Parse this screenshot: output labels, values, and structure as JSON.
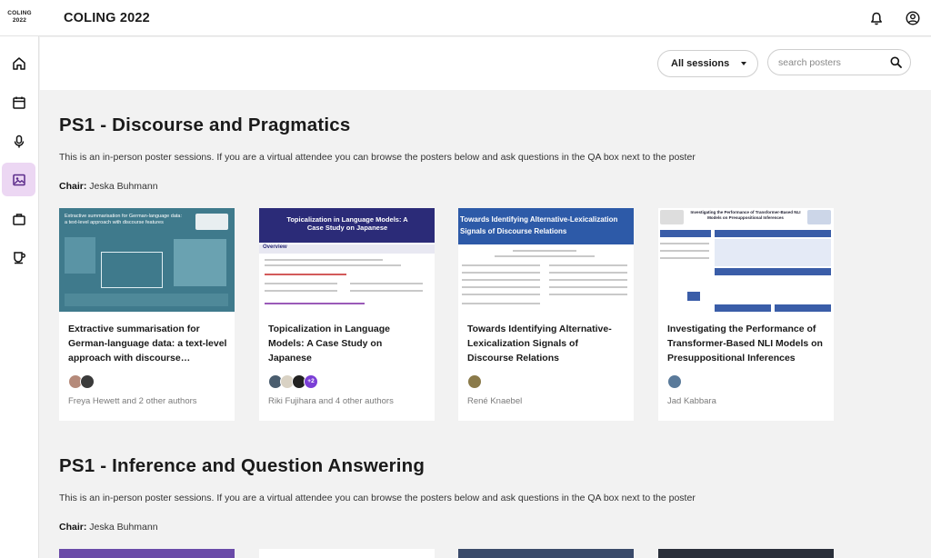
{
  "app": {
    "logo_line1": "COLING",
    "logo_line2": "2022",
    "title": "COLING 2022"
  },
  "topbar": {
    "icons": [
      "bell-icon",
      "account-icon"
    ]
  },
  "rail": {
    "items": [
      {
        "icon": "home-icon",
        "active": false
      },
      {
        "icon": "calendar-icon",
        "active": false
      },
      {
        "icon": "microphone-icon",
        "active": false
      },
      {
        "icon": "poster-image-icon",
        "active": true
      },
      {
        "icon": "briefcase-icon",
        "active": false
      },
      {
        "icon": "coffee-cup-icon",
        "active": false
      }
    ]
  },
  "filters": {
    "session_value": "All sessions",
    "search_placeholder": "search posters"
  },
  "sections": [
    {
      "title": "PS1 - Discourse and Pragmatics",
      "description": "This is an in-person poster sessions. If you are a virtual attendee you can browse the posters below and ask questions in the QA box next to the poster",
      "chair_label": "Chair:",
      "chair_name": "Jeska Buhmann",
      "cards": [
        {
          "thumb_title": "Extractive summarisation for German-language data: a text-level approach with discourse features",
          "title": "Extractive summarisation for German-language data: a text-level approach with discourse…",
          "authors": "Freya Hewett and 2 other authors"
        },
        {
          "thumb_title": "Topicalization in Language Models: A Case Study on Japanese",
          "thumb_section": "Overview",
          "title": "Topicalization in Language Models: A Case Study on Japanese",
          "authors": "Riki Fujihara and 4 other authors",
          "more_count": "+2"
        },
        {
          "thumb_title": "Towards Identifying Alternative-Lexicalization Signals of Discourse Relations",
          "title": "Towards Identifying Alternative-Lexicalization Signals of Discourse Relations",
          "authors": "René Knaebel"
        },
        {
          "thumb_title": "Investigating the Performance of Transformer-Based NLI Models on Presuppositional Inferences",
          "title": "Investigating the Performance of Transformer-Based NLI Models on Presuppositional Inferences",
          "authors": "Jad Kabbara"
        }
      ]
    },
    {
      "title": "PS1 - Inference and Question Answering",
      "description": "This is an in-person poster sessions. If you are a virtual attendee you can browse the posters below and ask questions in the QA box next to the poster",
      "chair_label": "Chair:",
      "chair_name": "Jeska Buhmann"
    }
  ],
  "colors": {
    "accent": "#ecd7f3",
    "more_badge": "#7b3fd6"
  }
}
